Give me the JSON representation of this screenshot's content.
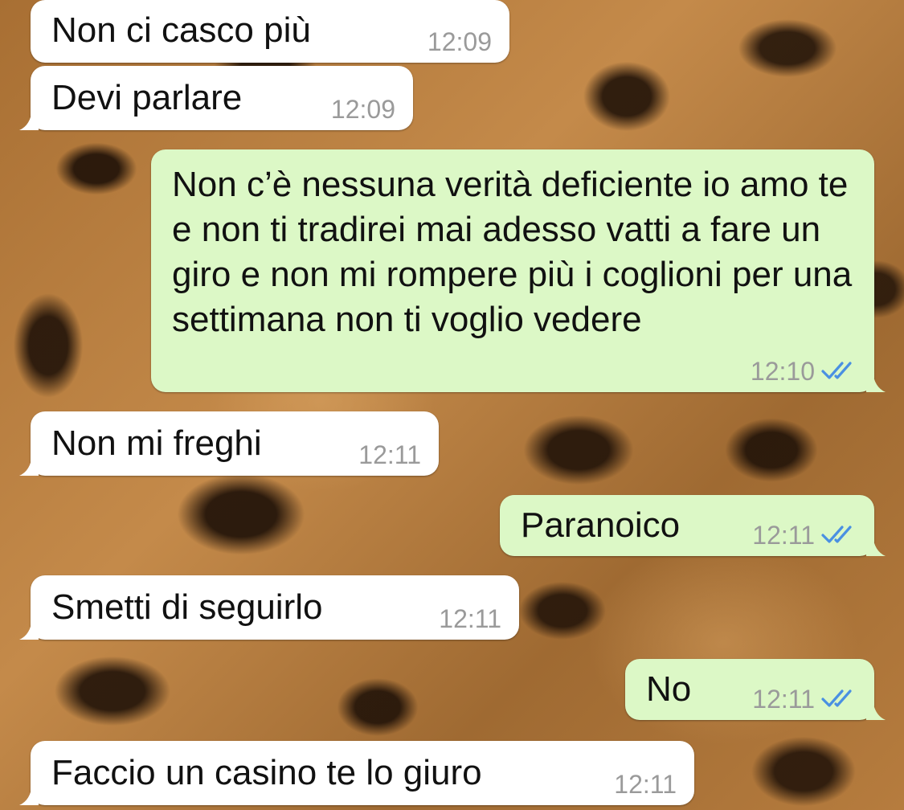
{
  "messages": [
    {
      "direction": "incoming",
      "text": "Non ci casco più",
      "time": "12:09"
    },
    {
      "direction": "incoming",
      "text": "Devi parlare",
      "time": "12:09"
    },
    {
      "direction": "outgoing",
      "text": "Non c’è nessuna verità deficiente io amo te e non ti tradirei mai adesso vatti a fare un giro e non mi rompere più i coglioni per una settimana non ti voglio vedere",
      "time": "12:10",
      "status": "read"
    },
    {
      "direction": "incoming",
      "text": "Non mi freghi",
      "time": "12:11"
    },
    {
      "direction": "outgoing",
      "text": "Paranoico",
      "time": "12:11",
      "status": "read"
    },
    {
      "direction": "incoming",
      "text": "Smetti di seguirlo",
      "time": "12:11"
    },
    {
      "direction": "outgoing",
      "text": "No",
      "time": "12:11",
      "status": "read"
    },
    {
      "direction": "incoming",
      "text": "Faccio un casino te lo giuro",
      "time": "12:11"
    }
  ],
  "colors": {
    "incoming_bubble": "#ffffff",
    "outgoing_bubble": "#dcf8c6",
    "read_ticks": "#4a90e2",
    "timestamp": "#9a9a9a"
  },
  "icons": {
    "read_status": "double-check-icon",
    "wallpaper": "leopard-print-wallpaper"
  }
}
